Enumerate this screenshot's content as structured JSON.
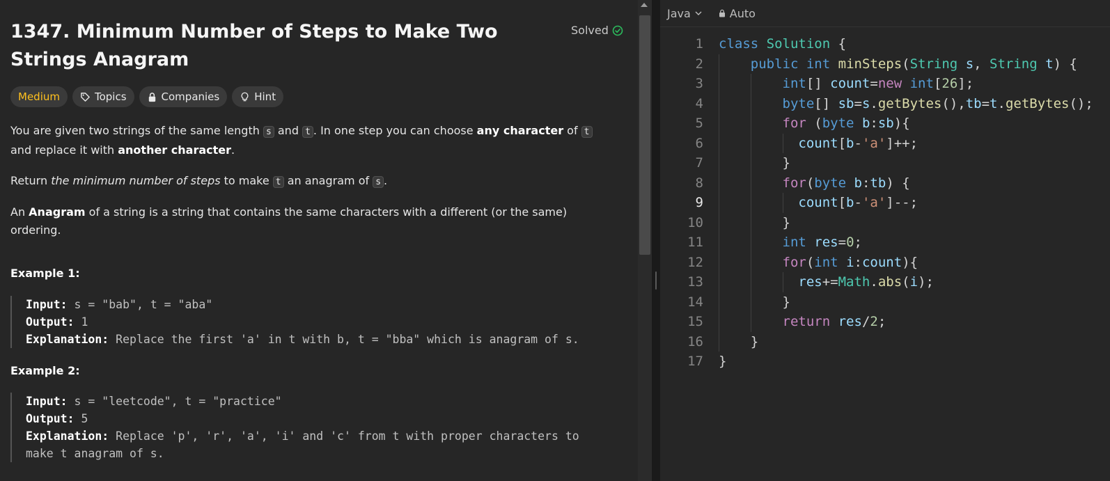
{
  "problem": {
    "title": "1347. Minimum Number of Steps to Make Two Strings Anagram",
    "status": "Solved",
    "tags": [
      "Medium",
      "Topics",
      "Companies",
      "Hint"
    ],
    "desc1": {
      "a": "You are given two strings of the same length ",
      "c1": "s",
      "b": " and ",
      "c2": "t",
      "c": ". In one step you can choose ",
      "d": "any character",
      "e": " of ",
      "c3": "t",
      "f": " and replace it with ",
      "g": "another character",
      "h": "."
    },
    "desc2": {
      "a": "Return ",
      "b": "the minimum number of steps",
      "c": " to make ",
      "c1": "t",
      "d": " an anagram of ",
      "c2": "s",
      "e": "."
    },
    "desc3": {
      "a": "An ",
      "b": "Anagram",
      "c": " of a string is a string that contains the same characters with a different (or the same) ordering."
    },
    "examples": [
      {
        "title": "Example 1:",
        "input_label": "Input:",
        "input": " s = \"bab\", t = \"aba\"",
        "output_label": "Output:",
        "output": " 1",
        "explanation_label": "Explanation:",
        "explanation": " Replace the first 'a' in t with b, t = \"bba\" which is anagram of s."
      },
      {
        "title": "Example 2:",
        "input_label": "Input:",
        "input": " s = \"leetcode\", t = \"practice\"",
        "output_label": "Output:",
        "output": " 5",
        "explanation_label": "Explanation:",
        "explanation": " Replace 'p', 'r', 'a', 'i' and 'c' from t with proper characters to",
        "explanation_cont": "make t anagram of s."
      }
    ]
  },
  "editor": {
    "language": "Java",
    "mode": "Auto",
    "active_line": 9,
    "lines": [
      "class Solution {",
      "    public int minSteps(String s, String t) {",
      "        int[] count=new int[26];",
      "        byte[] sb=s.getBytes(),tb=t.getBytes();",
      "        for (byte b:sb){",
      "          count[b-'a']++;",
      "        }",
      "        for(byte b:tb) {",
      "          count[b-'a']--;",
      "        }",
      "        int res=0;",
      "        for(int i:count){",
      "          res+=Math.abs(i);",
      "        }",
      "        return res/2;",
      "    }",
      "}"
    ]
  }
}
